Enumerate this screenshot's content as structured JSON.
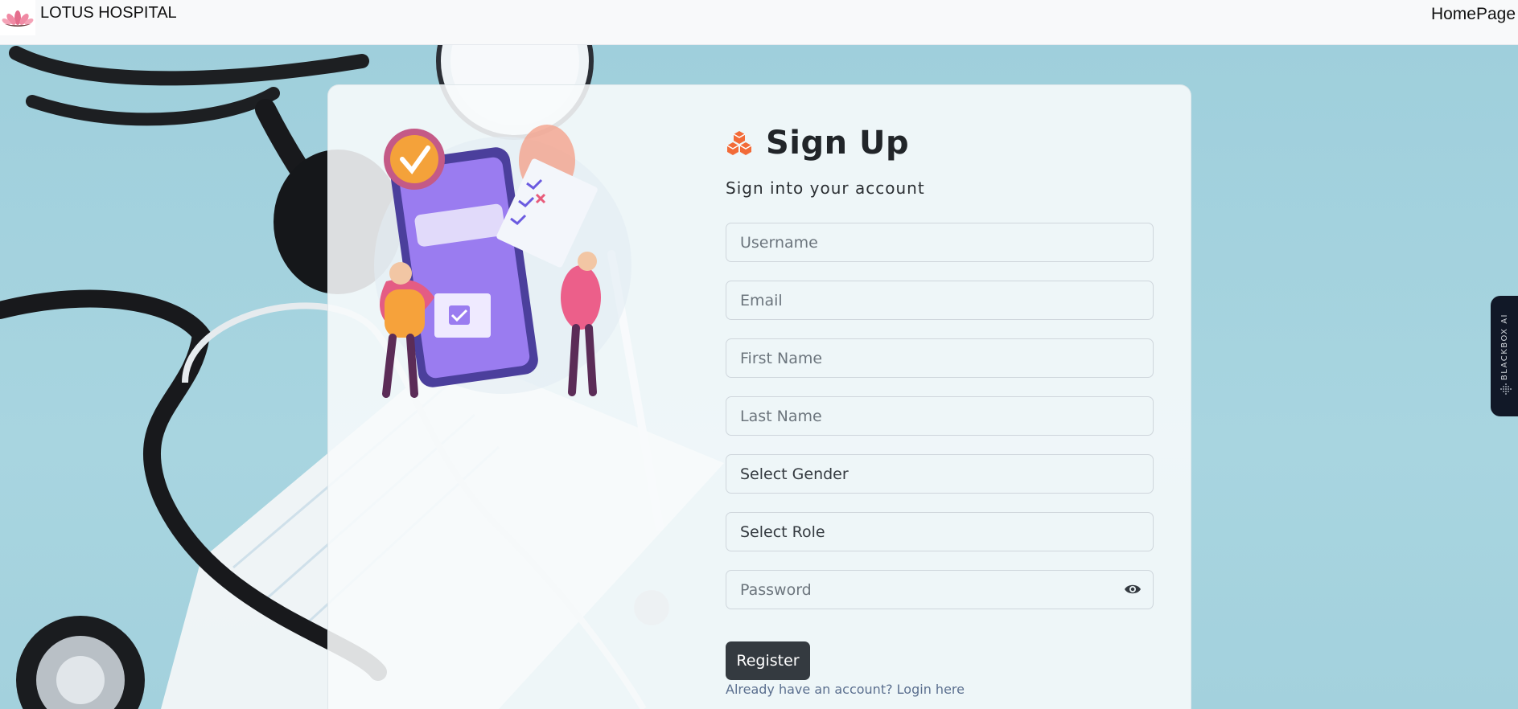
{
  "navbar": {
    "brand": "LOTUS HOSPITAL",
    "home_link": "HomePage"
  },
  "form": {
    "title": "Sign Up",
    "subtitle": "Sign into your account",
    "username_placeholder": "Username",
    "email_placeholder": "Email",
    "first_name_placeholder": "First Name",
    "last_name_placeholder": "Last Name",
    "gender_value": "Select Gender",
    "role_value": "Select Role",
    "password_placeholder": "Password",
    "register_label": "Register",
    "login_link": "Already have an account? Login here"
  },
  "side_tab": {
    "label": "BLACKBOX AI"
  },
  "icons": {
    "logo": "lotus-logo-icon",
    "title": "cubes-icon",
    "password_toggle": "eye-icon"
  },
  "colors": {
    "navbar_bg": "#f8f9fa",
    "background": "#a6d3df",
    "button_bg": "#343a40",
    "title_icon": "#f26b38",
    "link": "#5b6f8f"
  }
}
